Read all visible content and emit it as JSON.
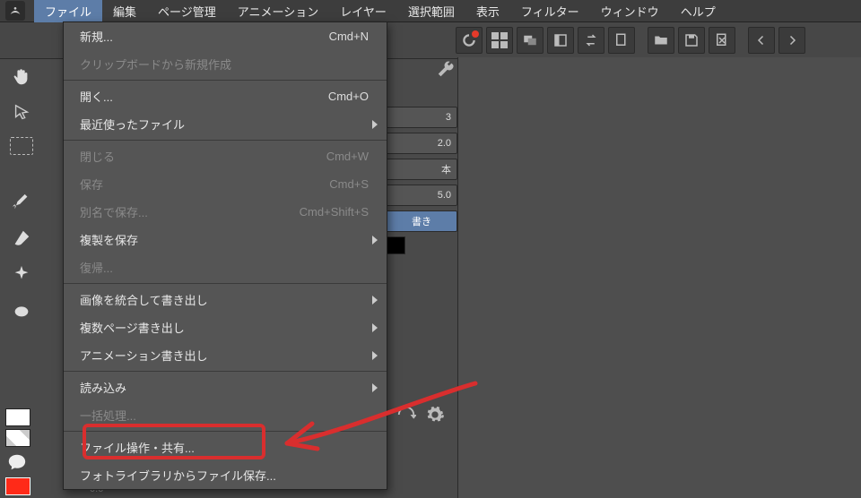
{
  "menubar": {
    "items": [
      "ファイル",
      "編集",
      "ページ管理",
      "アニメーション",
      "レイヤー",
      "選択範囲",
      "表示",
      "フィルター",
      "ウィンドウ",
      "ヘルプ"
    ],
    "open_index": 0
  },
  "file_menu": {
    "groups": [
      [
        {
          "label": "新規...",
          "shortcut": "Cmd+N"
        },
        {
          "label": "クリップボードから新規作成",
          "disabled": true
        }
      ],
      [
        {
          "label": "開く...",
          "shortcut": "Cmd+O"
        },
        {
          "label": "最近使ったファイル",
          "submenu": true
        }
      ],
      [
        {
          "label": "閉じる",
          "shortcut": "Cmd+W",
          "disabled": true
        },
        {
          "label": "保存",
          "shortcut": "Cmd+S",
          "disabled": true
        },
        {
          "label": "別名で保存...",
          "shortcut": "Cmd+Shift+S",
          "disabled": true
        },
        {
          "label": "複製を保存",
          "submenu": true
        },
        {
          "label": "復帰...",
          "disabled": true
        }
      ],
      [
        {
          "label": "画像を統合して書き出し",
          "submenu": true
        },
        {
          "label": "複数ページ書き出し",
          "submenu": true
        },
        {
          "label": "アニメーション書き出し",
          "submenu": true
        }
      ],
      [
        {
          "label": "読み込み",
          "submenu": true
        },
        {
          "label": "一括処理...",
          "disabled": true
        }
      ],
      [
        {
          "label": "ファイル操作・共有..."
        },
        {
          "label": "フォトライブラリからファイル保存..."
        }
      ]
    ]
  },
  "behind_panel": {
    "values": [
      "3",
      "2.0",
      "本",
      "5.0"
    ],
    "active_label": "書き",
    "small_value": "0.6"
  },
  "toolbar_icons": [
    "spiral",
    "grid",
    "windows",
    "panel",
    "swap",
    "new",
    "folder",
    "save",
    "delete",
    "prev",
    "next"
  ],
  "left_tools": [
    "hand",
    "pointer",
    "marquee",
    "pen",
    "brush",
    "fx",
    "blob"
  ],
  "swatches": [
    "white",
    "diag",
    "speech",
    "red"
  ]
}
